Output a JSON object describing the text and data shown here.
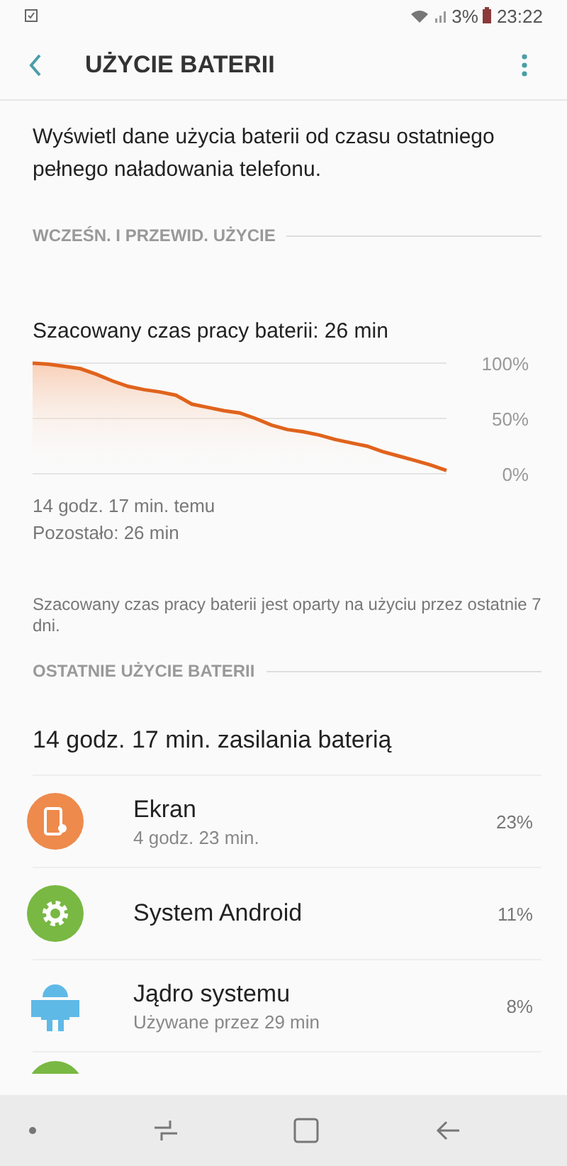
{
  "status_bar": {
    "battery_text": "3%",
    "time": "23:22"
  },
  "header": {
    "title": "UŻYCIE BATERII"
  },
  "description": "Wyświetl dane użycia baterii od czasu ostatniego pełnego naładowania telefonu.",
  "section_1": {
    "title": "WCZEŚN. I PRZEWID. UŻYCIE",
    "estimate": "Szacowany czas pracy baterii: 26 min",
    "chart_data": {
      "type": "area",
      "yticks": [
        {
          "value": 100,
          "label": "100%"
        },
        {
          "value": 50,
          "label": "50%"
        },
        {
          "value": 0,
          "label": "0%"
        }
      ],
      "ylim": [
        0,
        100
      ],
      "series": [
        {
          "color": "#e0631c",
          "values": [
            100,
            99,
            97,
            95,
            90,
            84,
            79,
            76,
            74,
            71,
            63,
            60,
            57,
            55,
            50,
            44,
            40,
            38,
            35,
            31,
            28,
            25,
            20,
            16,
            12,
            8,
            3
          ]
        }
      ]
    },
    "since": "14 godz. 17 min. temu",
    "remaining": "Pozostało: 26 min",
    "note": "Szacowany czas pracy baterii jest oparty na użyciu przez ostatnie 7 dni."
  },
  "section_2": {
    "title": "OSTATNIE UŻYCIE BATERII",
    "total": "14 godz. 17 min. zasilania baterią",
    "items": [
      {
        "kind": "screen",
        "color": "#ee8a4c",
        "name": "Ekran",
        "detail": "4 godz. 23 min.",
        "percent": "23%"
      },
      {
        "kind": "gear",
        "color": "#78b843",
        "name": "System Android",
        "percent": "11%"
      },
      {
        "kind": "android",
        "color": "#5fb9e6",
        "name": "Jądro systemu",
        "detail": "Używane przez 29 min",
        "percent": "8%"
      },
      {
        "kind": "cut-off",
        "color": "#78b843"
      }
    ]
  }
}
